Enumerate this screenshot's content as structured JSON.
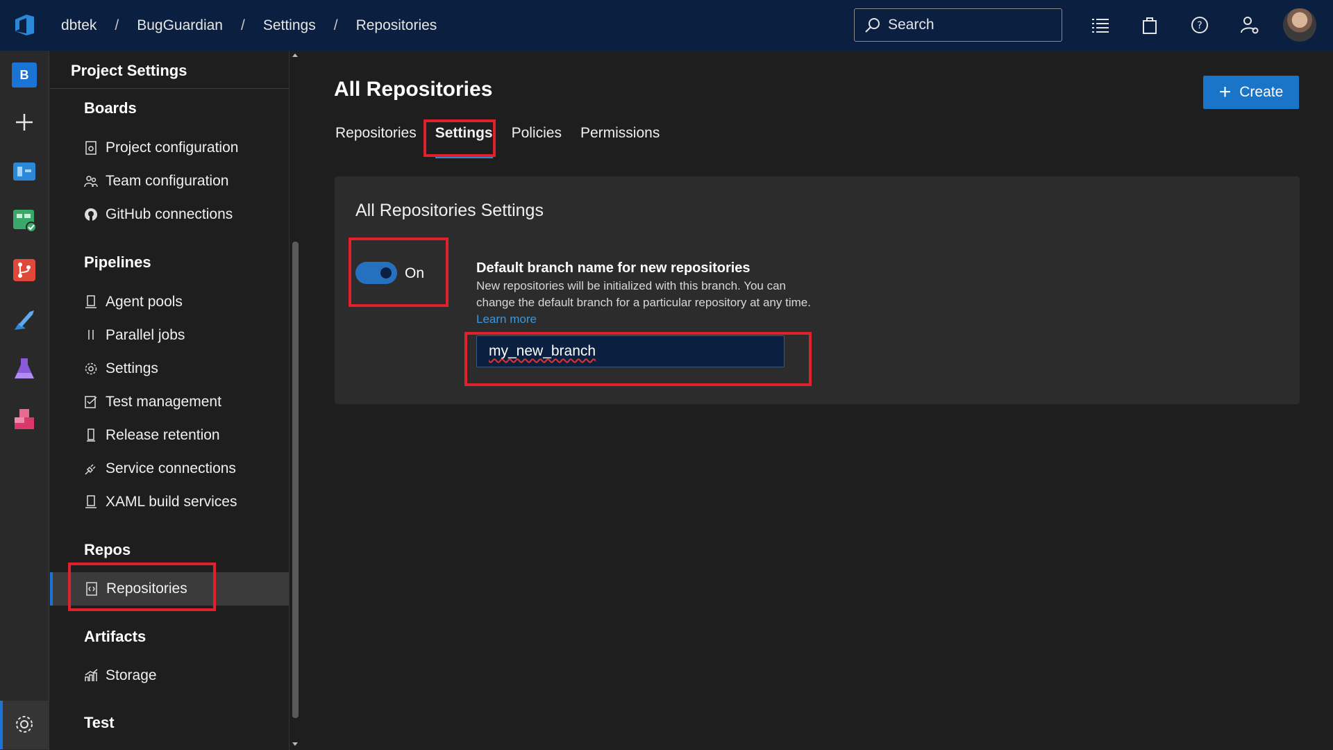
{
  "topbar": {
    "breadcrumb": [
      "dbtek",
      "BugGuardian",
      "Settings",
      "Repositories"
    ],
    "separator": "/",
    "search_placeholder": "Search"
  },
  "rail": {
    "project_initial": "B"
  },
  "sidebar": {
    "title": "Project Settings",
    "sections": [
      {
        "label": "Boards",
        "items": [
          "Project configuration",
          "Team configuration",
          "GitHub connections"
        ]
      },
      {
        "label": "Pipelines",
        "items": [
          "Agent pools",
          "Parallel jobs",
          "Settings",
          "Test management",
          "Release retention",
          "Service connections",
          "XAML build services"
        ]
      },
      {
        "label": "Repos",
        "items": [
          "Repositories"
        ]
      },
      {
        "label": "Artifacts",
        "items": [
          "Storage"
        ]
      },
      {
        "label": "Test",
        "items": []
      }
    ],
    "selected_item": "Repositories"
  },
  "main": {
    "title": "All Repositories",
    "create_label": "Create",
    "tabs": [
      "Repositories",
      "Settings",
      "Policies",
      "Permissions"
    ],
    "active_tab": "Settings",
    "card": {
      "title": "All Repositories Settings",
      "toggle_state": "On",
      "toggle_on": true,
      "setting_title": "Default branch name for new repositories",
      "setting_desc": "New repositories will be initialized with this branch. You can change the default branch for a particular repository at any time.",
      "learn_more": "Learn more",
      "branch_value": "my_new_branch"
    }
  },
  "colors": {
    "topbar": "#0b2040",
    "accent": "#1a74c8",
    "highlight": "#e0202c"
  }
}
